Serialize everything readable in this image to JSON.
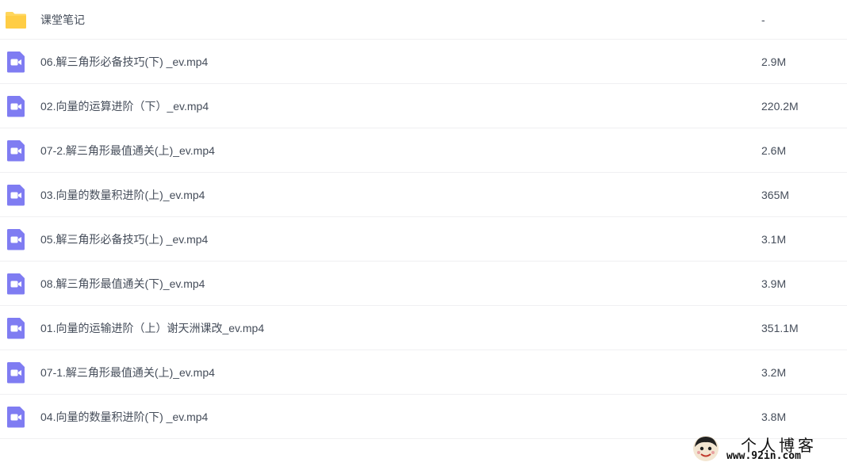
{
  "files": [
    {
      "type": "folder",
      "name": "课堂笔记",
      "size": "-"
    },
    {
      "type": "video",
      "name": "06.解三角形必备技巧(下) _ev.mp4",
      "size": "2.9M"
    },
    {
      "type": "video",
      "name": "02.向量的运算进阶（下）_ev.mp4",
      "size": "220.2M"
    },
    {
      "type": "video",
      "name": "07-2.解三角形最值通关(上)_ev.mp4",
      "size": "2.6M"
    },
    {
      "type": "video",
      "name": "03.向量的数量积进阶(上)_ev.mp4",
      "size": "365M"
    },
    {
      "type": "video",
      "name": "05.解三角形必备技巧(上) _ev.mp4",
      "size": "3.1M"
    },
    {
      "type": "video",
      "name": "08.解三角形最值通关(下)_ev.mp4",
      "size": "3.9M"
    },
    {
      "type": "video",
      "name": "01.向量的运输进阶（上）谢天洲课改_ev.mp4",
      "size": "351.1M"
    },
    {
      "type": "video",
      "name": "07-1.解三角形最值通关(上)_ev.mp4",
      "size": "3.2M"
    },
    {
      "type": "video",
      "name": "04.向量的数量积进阶(下) _ev.mp4",
      "size": "3.8M"
    }
  ],
  "watermark": {
    "title": "个人博客",
    "url": "www.92in.com"
  },
  "colors": {
    "folder": "#ffd65c",
    "video": "#7f7cf2",
    "text": "#454d5a",
    "divider": "#f0f0f2"
  }
}
